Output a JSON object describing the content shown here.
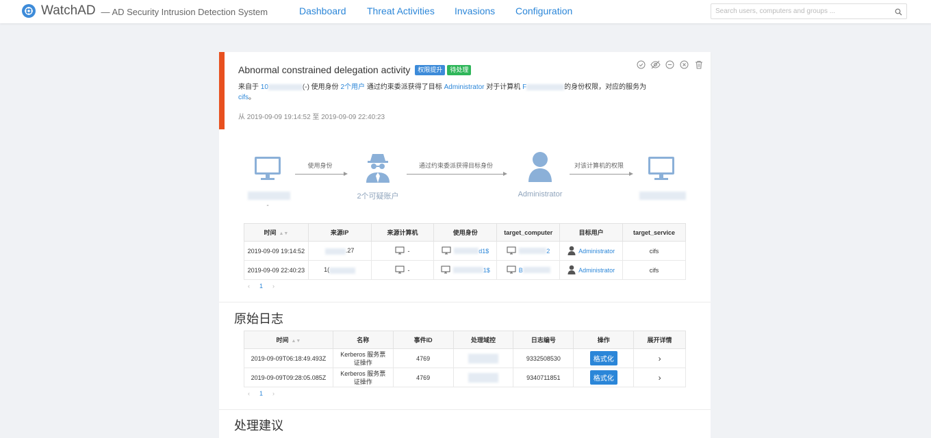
{
  "header": {
    "app_name": "WatchAD",
    "subtitle": "— AD Security Intrusion Detection System",
    "nav": [
      "Dashboard",
      "Threat Activities",
      "Invasions",
      "Configuration"
    ],
    "search_placeholder": "Search users, computers and groups ..."
  },
  "alert": {
    "title": "Abnormal constrained delegation activity",
    "tags": [
      "权限提升",
      "待处理"
    ],
    "desc": {
      "p1": "来自于",
      "ip_prefix": "10",
      "p2": "(-) 使用身份",
      "users_link": "2个用户",
      "p3": "通过约束委派获得了目标",
      "target_user": "Administrator",
      "p4": "对于计算机",
      "computer_prefix": "F",
      "p5": "的身份权限，对应的服务为",
      "service": "cifs",
      "p6": "。"
    },
    "time_range": "从 2019-09-09 19:14:52 至 2019-09-09 22:40:23"
  },
  "flow": {
    "step1_label": "使用身份",
    "step2_label": "通过约束委派获得目标身份",
    "step3_label": "对该计算机的权限",
    "source_sub": "-",
    "users_label": "2个可疑账户",
    "admin_label": "Administrator"
  },
  "activity_table": {
    "headers": [
      "时间",
      "来源IP",
      "来源计算机",
      "使用身份",
      "target_computer",
      "目标用户",
      "target_service"
    ],
    "rows": [
      {
        "time": "2019-09-09 19:14:52",
        "ip_suffix": ".27",
        "src_comp": "-",
        "identity_suffix": "d1$",
        "target_comp_suffix": "2",
        "target_user": "Administrator",
        "service": "cifs"
      },
      {
        "time": "2019-09-09 22:40:23",
        "ip_suffix": "1(",
        "src_comp": "-",
        "identity_suffix": "1$",
        "target_comp_suffix": "B",
        "target_user": "Administrator",
        "service": "cifs"
      }
    ],
    "page": "1"
  },
  "raw_logs": {
    "title": "原始日志",
    "headers": [
      "时间",
      "名称",
      "事件ID",
      "处理域控",
      "日志编号",
      "操作",
      "展开详情"
    ],
    "rows": [
      {
        "time": "2019-09-09T06:18:49.493Z",
        "name": "Kerberos 服务票证操作",
        "event_id": "4769",
        "log_id": "9332508530",
        "action": "格式化",
        "expand": "›"
      },
      {
        "time": "2019-09-09T09:28:05.085Z",
        "name": "Kerberos 服务票证操作",
        "event_id": "4769",
        "log_id": "9340711851",
        "action": "格式化",
        "expand": "›"
      }
    ],
    "page": "1"
  },
  "advice": {
    "title": "处理建议"
  },
  "colors": {
    "accent": "#2b86d8",
    "alert_border": "#e8501f",
    "tag_blue": "#3d8bd9",
    "tag_green": "#2fb65a"
  }
}
